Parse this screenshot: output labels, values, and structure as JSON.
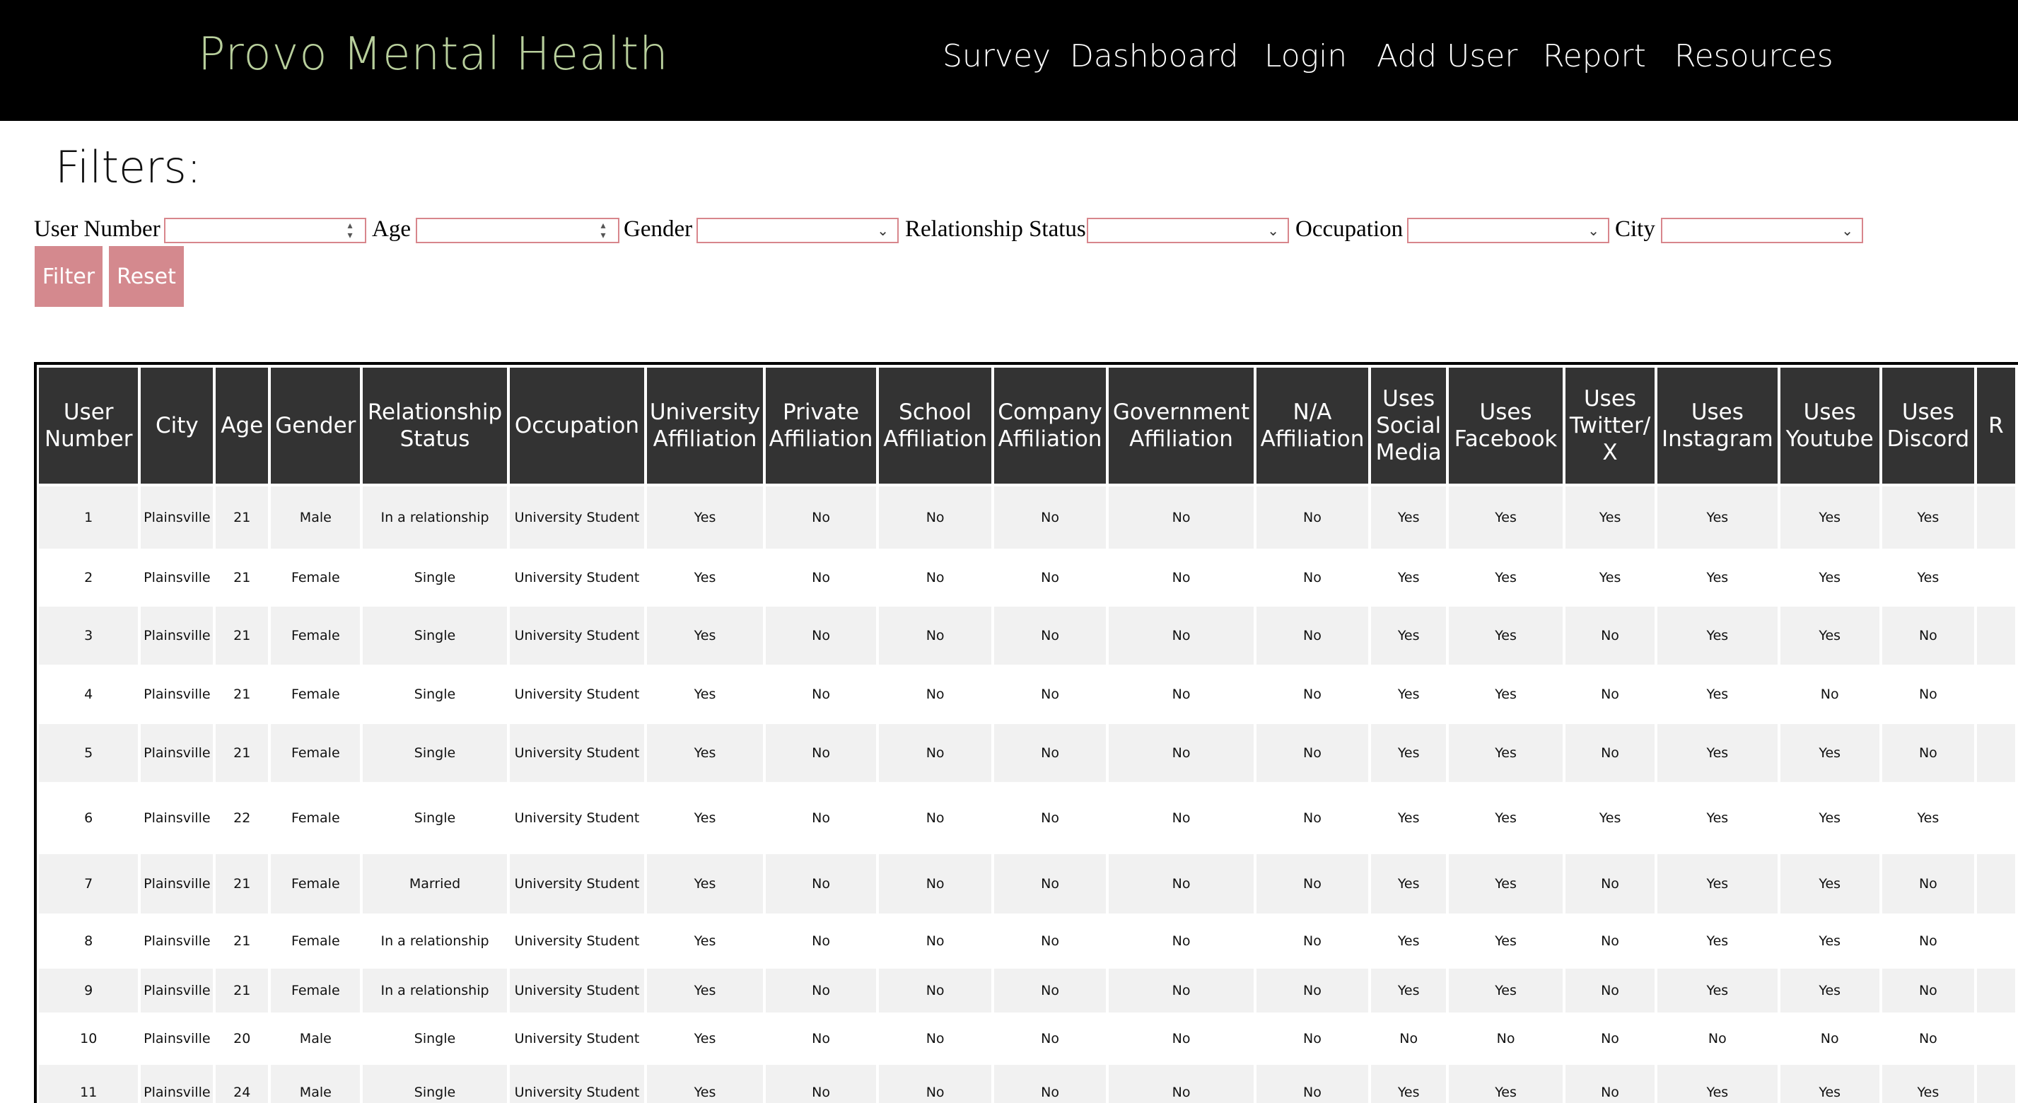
{
  "navbar": {
    "brand": "Provo Mental Health",
    "links": [
      "Survey",
      "Dashboard",
      "Login",
      "Add User",
      "Report",
      "Resources"
    ]
  },
  "filters": {
    "title": "Filters:",
    "labels": {
      "user_number": "User Number",
      "age": "Age",
      "gender": "Gender",
      "relationship_status": "Relationship Status",
      "occupation": "Occupation",
      "city": "City"
    },
    "filter_button": "Filter",
    "reset_button": "Reset"
  },
  "colors": {
    "navbar_bg": "#000000",
    "brand": "#b8cf9c",
    "accent": "#d4898e",
    "header_bg": "#333333",
    "row_stripe": "#f1f1f1"
  },
  "table": {
    "columns": [
      "User Number",
      "City",
      "Age",
      "Gender",
      "Relationship Status",
      "Occupation",
      "University Affiliation",
      "Private Affiliation",
      "School Affiliation",
      "Company Affiliation",
      "Government Affiliation",
      "N/A Affiliation",
      "Uses Social Media",
      "Uses Facebook",
      "Uses Twitter/ X",
      "Uses Instagram",
      "Uses Youtube",
      "Uses Discord",
      "R"
    ],
    "rows": [
      [
        "1",
        "Plainsville",
        "21",
        "Male",
        "In a relationship",
        "University Student",
        "Yes",
        "No",
        "No",
        "No",
        "No",
        "No",
        "Yes",
        "Yes",
        "Yes",
        "Yes",
        "Yes",
        "Yes",
        ""
      ],
      [
        "2",
        "Plainsville",
        "21",
        "Female",
        "Single",
        "University Student",
        "Yes",
        "No",
        "No",
        "No",
        "No",
        "No",
        "Yes",
        "Yes",
        "Yes",
        "Yes",
        "Yes",
        "Yes",
        ""
      ],
      [
        "3",
        "Plainsville",
        "21",
        "Female",
        "Single",
        "University Student",
        "Yes",
        "No",
        "No",
        "No",
        "No",
        "No",
        "Yes",
        "Yes",
        "No",
        "Yes",
        "Yes",
        "No",
        ""
      ],
      [
        "4",
        "Plainsville",
        "21",
        "Female",
        "Single",
        "University Student",
        "Yes",
        "No",
        "No",
        "No",
        "No",
        "No",
        "Yes",
        "Yes",
        "No",
        "Yes",
        "No",
        "No",
        ""
      ],
      [
        "5",
        "Plainsville",
        "21",
        "Female",
        "Single",
        "University Student",
        "Yes",
        "No",
        "No",
        "No",
        "No",
        "No",
        "Yes",
        "Yes",
        "No",
        "Yes",
        "Yes",
        "No",
        ""
      ],
      [
        "6",
        "Plainsville",
        "22",
        "Female",
        "Single",
        "University Student",
        "Yes",
        "No",
        "No",
        "No",
        "No",
        "No",
        "Yes",
        "Yes",
        "Yes",
        "Yes",
        "Yes",
        "Yes",
        ""
      ],
      [
        "7",
        "Plainsville",
        "21",
        "Female",
        "Married",
        "University Student",
        "Yes",
        "No",
        "No",
        "No",
        "No",
        "No",
        "Yes",
        "Yes",
        "No",
        "Yes",
        "Yes",
        "No",
        ""
      ],
      [
        "8",
        "Plainsville",
        "21",
        "Female",
        "In a relationship",
        "University Student",
        "Yes",
        "No",
        "No",
        "No",
        "No",
        "No",
        "Yes",
        "Yes",
        "No",
        "Yes",
        "Yes",
        "No",
        ""
      ],
      [
        "9",
        "Plainsville",
        "21",
        "Female",
        "In a relationship",
        "University Student",
        "Yes",
        "No",
        "No",
        "No",
        "No",
        "No",
        "Yes",
        "Yes",
        "No",
        "Yes",
        "Yes",
        "No",
        ""
      ],
      [
        "10",
        "Plainsville",
        "20",
        "Male",
        "Single",
        "University Student",
        "Yes",
        "No",
        "No",
        "No",
        "No",
        "No",
        "No",
        "No",
        "No",
        "No",
        "No",
        "No",
        ""
      ],
      [
        "11",
        "Plainsville",
        "24",
        "Male",
        "Single",
        "University Student",
        "Yes",
        "No",
        "No",
        "No",
        "No",
        "No",
        "Yes",
        "Yes",
        "No",
        "Yes",
        "Yes",
        "Yes",
        ""
      ]
    ]
  }
}
